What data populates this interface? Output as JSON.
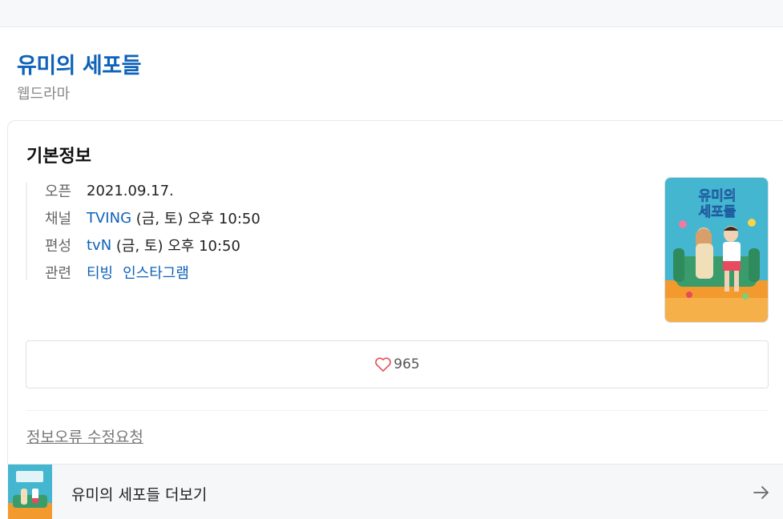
{
  "header": {
    "title": "유미의 세포들",
    "subtitle": "웹드라마"
  },
  "basic_info": {
    "section_title": "기본정보",
    "rows": [
      {
        "label": "오픈",
        "value": "2021.09.17."
      },
      {
        "label": "채널",
        "link": "TVING",
        "value": " (금, 토) 오후 10:50"
      },
      {
        "label": "편성",
        "link": "tvN",
        "value": " (금, 토) 오후 10:50"
      },
      {
        "label": "관련",
        "links": [
          "티빙",
          "인스타그램"
        ]
      }
    ],
    "poster": {
      "title_lines": [
        "유미의",
        "세포들"
      ]
    }
  },
  "like": {
    "icon": "heart-icon",
    "count": "965",
    "color": "#e8505b"
  },
  "report_link": "정보오류 수정요청",
  "more": {
    "label": "유미의 세포들 더보기",
    "icon": "arrow-right-icon"
  },
  "colors": {
    "accent": "#0e62b8",
    "poster_sky": "#3fb3cc",
    "poster_floor": "#f39a2c",
    "sofa": "#3a9c6b"
  }
}
